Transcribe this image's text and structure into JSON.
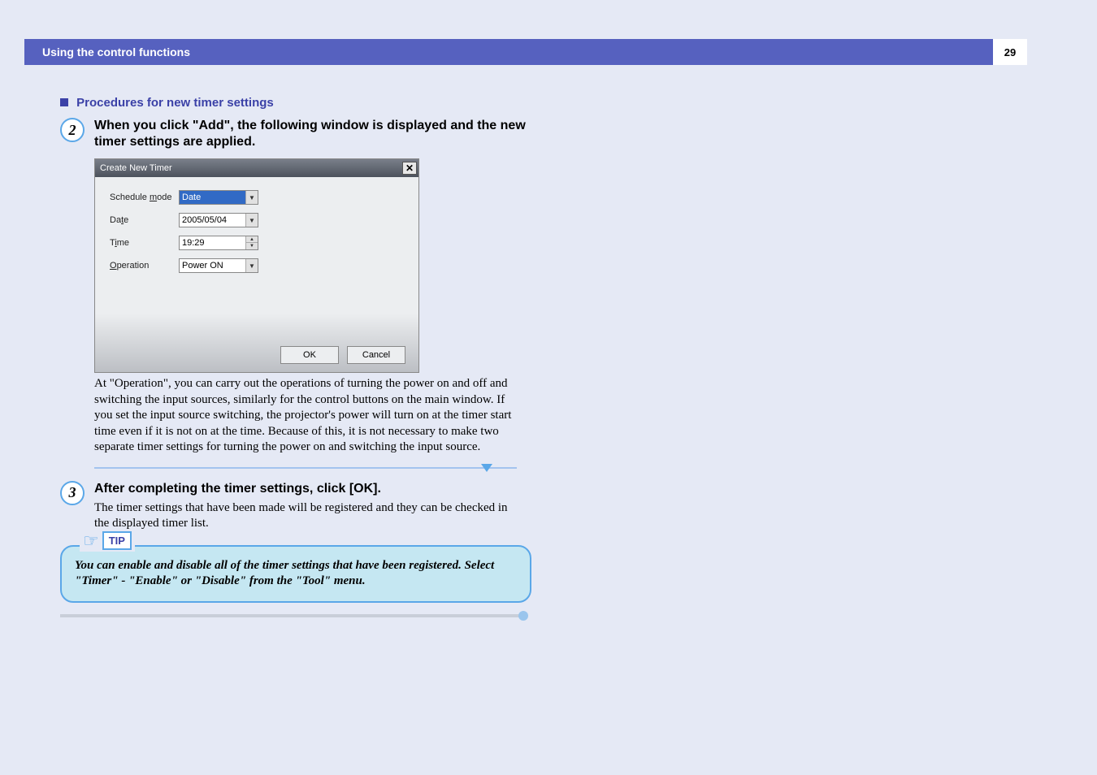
{
  "banner": {
    "title": "Using the control functions",
    "page_number": "29"
  },
  "section_heading": "Procedures for new timer settings",
  "step2": {
    "number": "2",
    "heading": "When you click \"Add\", the following window is displayed and the new timer settings are applied.",
    "paragraph": "At \"Operation\", you can carry out the operations of turning the power on and off and switching the input sources, similarly for the control buttons on the main window. If you set the input source switching, the projector's power will turn on at the timer start time even if it is not on at the time. Because of this, it is not necessary to make two separate timer settings for turning the power on and switching the input source."
  },
  "dialog": {
    "title": "Create New Timer",
    "labels": {
      "schedule_mode": "Schedule mode",
      "schedule_mode_u": "m",
      "date": "Date",
      "date_u": "t",
      "time": "Time",
      "time_u": "i",
      "operation": "Operation",
      "operation_u": "O"
    },
    "values": {
      "schedule_mode": "Date",
      "date": "2005/05/04",
      "time": "19:29",
      "operation": "Power ON"
    },
    "buttons": {
      "ok": "OK",
      "cancel": "Cancel"
    }
  },
  "step3": {
    "number": "3",
    "heading": "After completing the timer settings, click [OK].",
    "paragraph": "The timer settings that have been made will be registered and they can be checked in the displayed timer list."
  },
  "tip": {
    "label": "TIP",
    "text": "You can enable and disable all of the timer settings that have been registered. Select \"Timer\" - \"Enable\" or \"Disable\" from the \"Tool\" menu."
  }
}
